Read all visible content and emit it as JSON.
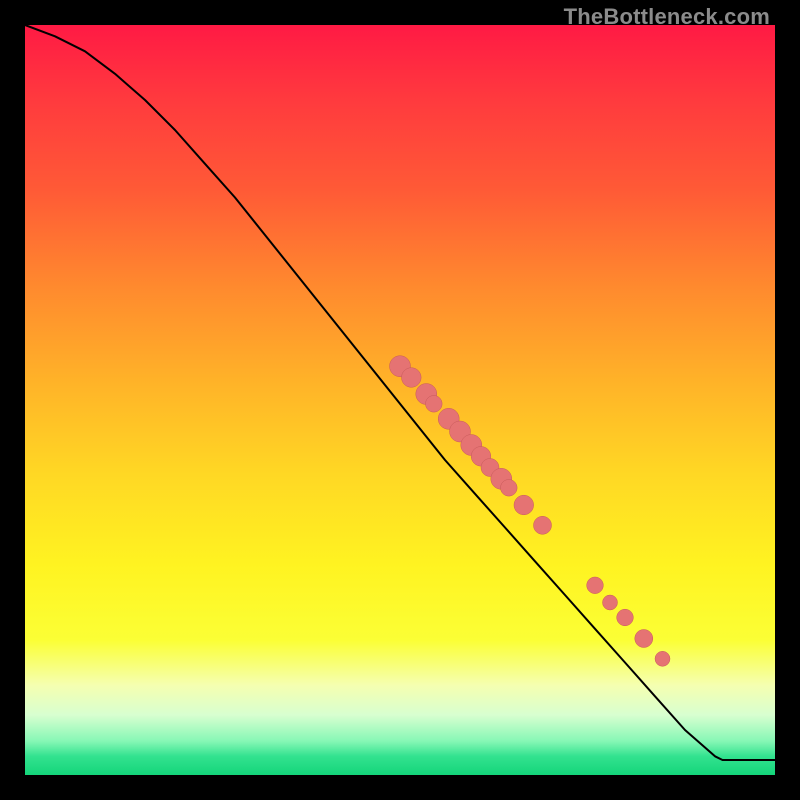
{
  "watermark": "TheBottleneck.com",
  "colors": {
    "page_bg": "#000000",
    "curve": "#000000",
    "marker_fill": "#e57373",
    "marker_stroke": "#c75a5a"
  },
  "gradient_stops": [
    {
      "offset": 0.0,
      "color": "#ff1a44"
    },
    {
      "offset": 0.1,
      "color": "#ff3a3e"
    },
    {
      "offset": 0.22,
      "color": "#ff5a36"
    },
    {
      "offset": 0.35,
      "color": "#ff8a2e"
    },
    {
      "offset": 0.48,
      "color": "#ffb428"
    },
    {
      "offset": 0.6,
      "color": "#ffd824"
    },
    {
      "offset": 0.72,
      "color": "#fff321"
    },
    {
      "offset": 0.82,
      "color": "#fbff35"
    },
    {
      "offset": 0.88,
      "color": "#f5ffb0"
    },
    {
      "offset": 0.92,
      "color": "#d8ffd0"
    },
    {
      "offset": 0.955,
      "color": "#86f7b5"
    },
    {
      "offset": 0.975,
      "color": "#33e28f"
    },
    {
      "offset": 1.0,
      "color": "#14d57a"
    }
  ],
  "chart_data": {
    "type": "line",
    "title": "",
    "xlabel": "",
    "ylabel": "",
    "xlim": [
      0,
      100
    ],
    "ylim": [
      0,
      100
    ],
    "series": [
      {
        "name": "curve",
        "x": [
          0,
          4,
          8,
          12,
          16,
          20,
          24,
          28,
          32,
          36,
          40,
          44,
          48,
          52,
          56,
          60,
          64,
          68,
          72,
          76,
          80,
          84,
          88,
          92,
          93,
          96,
          100
        ],
        "y": [
          100,
          98.5,
          96.5,
          93.5,
          90,
          86,
          81.5,
          77,
          72,
          67,
          62,
          57,
          52,
          47,
          42,
          37.5,
          33,
          28.5,
          24,
          19.5,
          15,
          10.5,
          6,
          2.5,
          2,
          2,
          2
        ]
      }
    ],
    "markers": [
      {
        "x": 50.0,
        "y": 54.5,
        "r": 1.4
      },
      {
        "x": 51.5,
        "y": 53.0,
        "r": 1.3
      },
      {
        "x": 53.5,
        "y": 50.8,
        "r": 1.4
      },
      {
        "x": 54.5,
        "y": 49.5,
        "r": 1.1
      },
      {
        "x": 56.5,
        "y": 47.5,
        "r": 1.4
      },
      {
        "x": 58.0,
        "y": 45.8,
        "r": 1.4
      },
      {
        "x": 59.5,
        "y": 44.0,
        "r": 1.4
      },
      {
        "x": 60.8,
        "y": 42.5,
        "r": 1.3
      },
      {
        "x": 62.0,
        "y": 41.0,
        "r": 1.2
      },
      {
        "x": 63.5,
        "y": 39.5,
        "r": 1.4
      },
      {
        "x": 64.5,
        "y": 38.3,
        "r": 1.1
      },
      {
        "x": 66.5,
        "y": 36.0,
        "r": 1.3
      },
      {
        "x": 69.0,
        "y": 33.3,
        "r": 1.2
      },
      {
        "x": 76.0,
        "y": 25.3,
        "r": 1.1
      },
      {
        "x": 78.0,
        "y": 23.0,
        "r": 1.0
      },
      {
        "x": 80.0,
        "y": 21.0,
        "r": 1.1
      },
      {
        "x": 82.5,
        "y": 18.2,
        "r": 1.2
      },
      {
        "x": 85.0,
        "y": 15.5,
        "r": 1.0
      }
    ]
  }
}
